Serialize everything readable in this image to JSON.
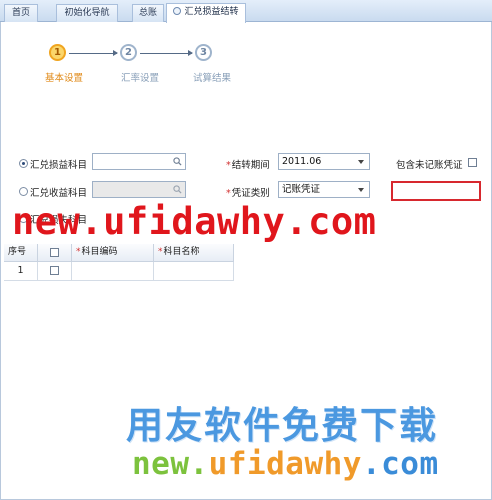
{
  "tabs": [
    {
      "label": "首页"
    },
    {
      "label": "初始化导航"
    },
    {
      "label": "总账"
    },
    {
      "label": "汇兑损益结转",
      "active": true
    }
  ],
  "wizard": {
    "steps": [
      {
        "number": "1",
        "label": "基本设置",
        "state": "done"
      },
      {
        "number": "2",
        "label": "汇率设置",
        "state": "todo"
      },
      {
        "number": "3",
        "label": "试算结果",
        "state": "todo"
      }
    ]
  },
  "form": {
    "account_radio_label": "汇兑损益科目",
    "income_radio_label": "汇兑收益科目",
    "loss_label": "汇兑损失科目",
    "period_label": "结转期间",
    "period_value": "2011.06",
    "voucher_type_label": "凭证类别",
    "voucher_type_value": "记账凭证",
    "include_unposted_label": "包含未记账凭证"
  },
  "table": {
    "columns": [
      "序号",
      "",
      "科目编码",
      "科目名称"
    ],
    "rows": [
      {
        "seq": "1",
        "code": "",
        "name": ""
      }
    ]
  },
  "watermarks": {
    "top": "new.ufidawhy.com",
    "middle": "用友软件免费下载",
    "bottom_parts": [
      "new.",
      "ufidawhy",
      ".com"
    ]
  },
  "colors": {
    "accent_orange": "#f0a520",
    "watermark_red": "#e0161c",
    "watermark_blue": "#4b98e0",
    "watermark_green": "#7cc23d"
  }
}
